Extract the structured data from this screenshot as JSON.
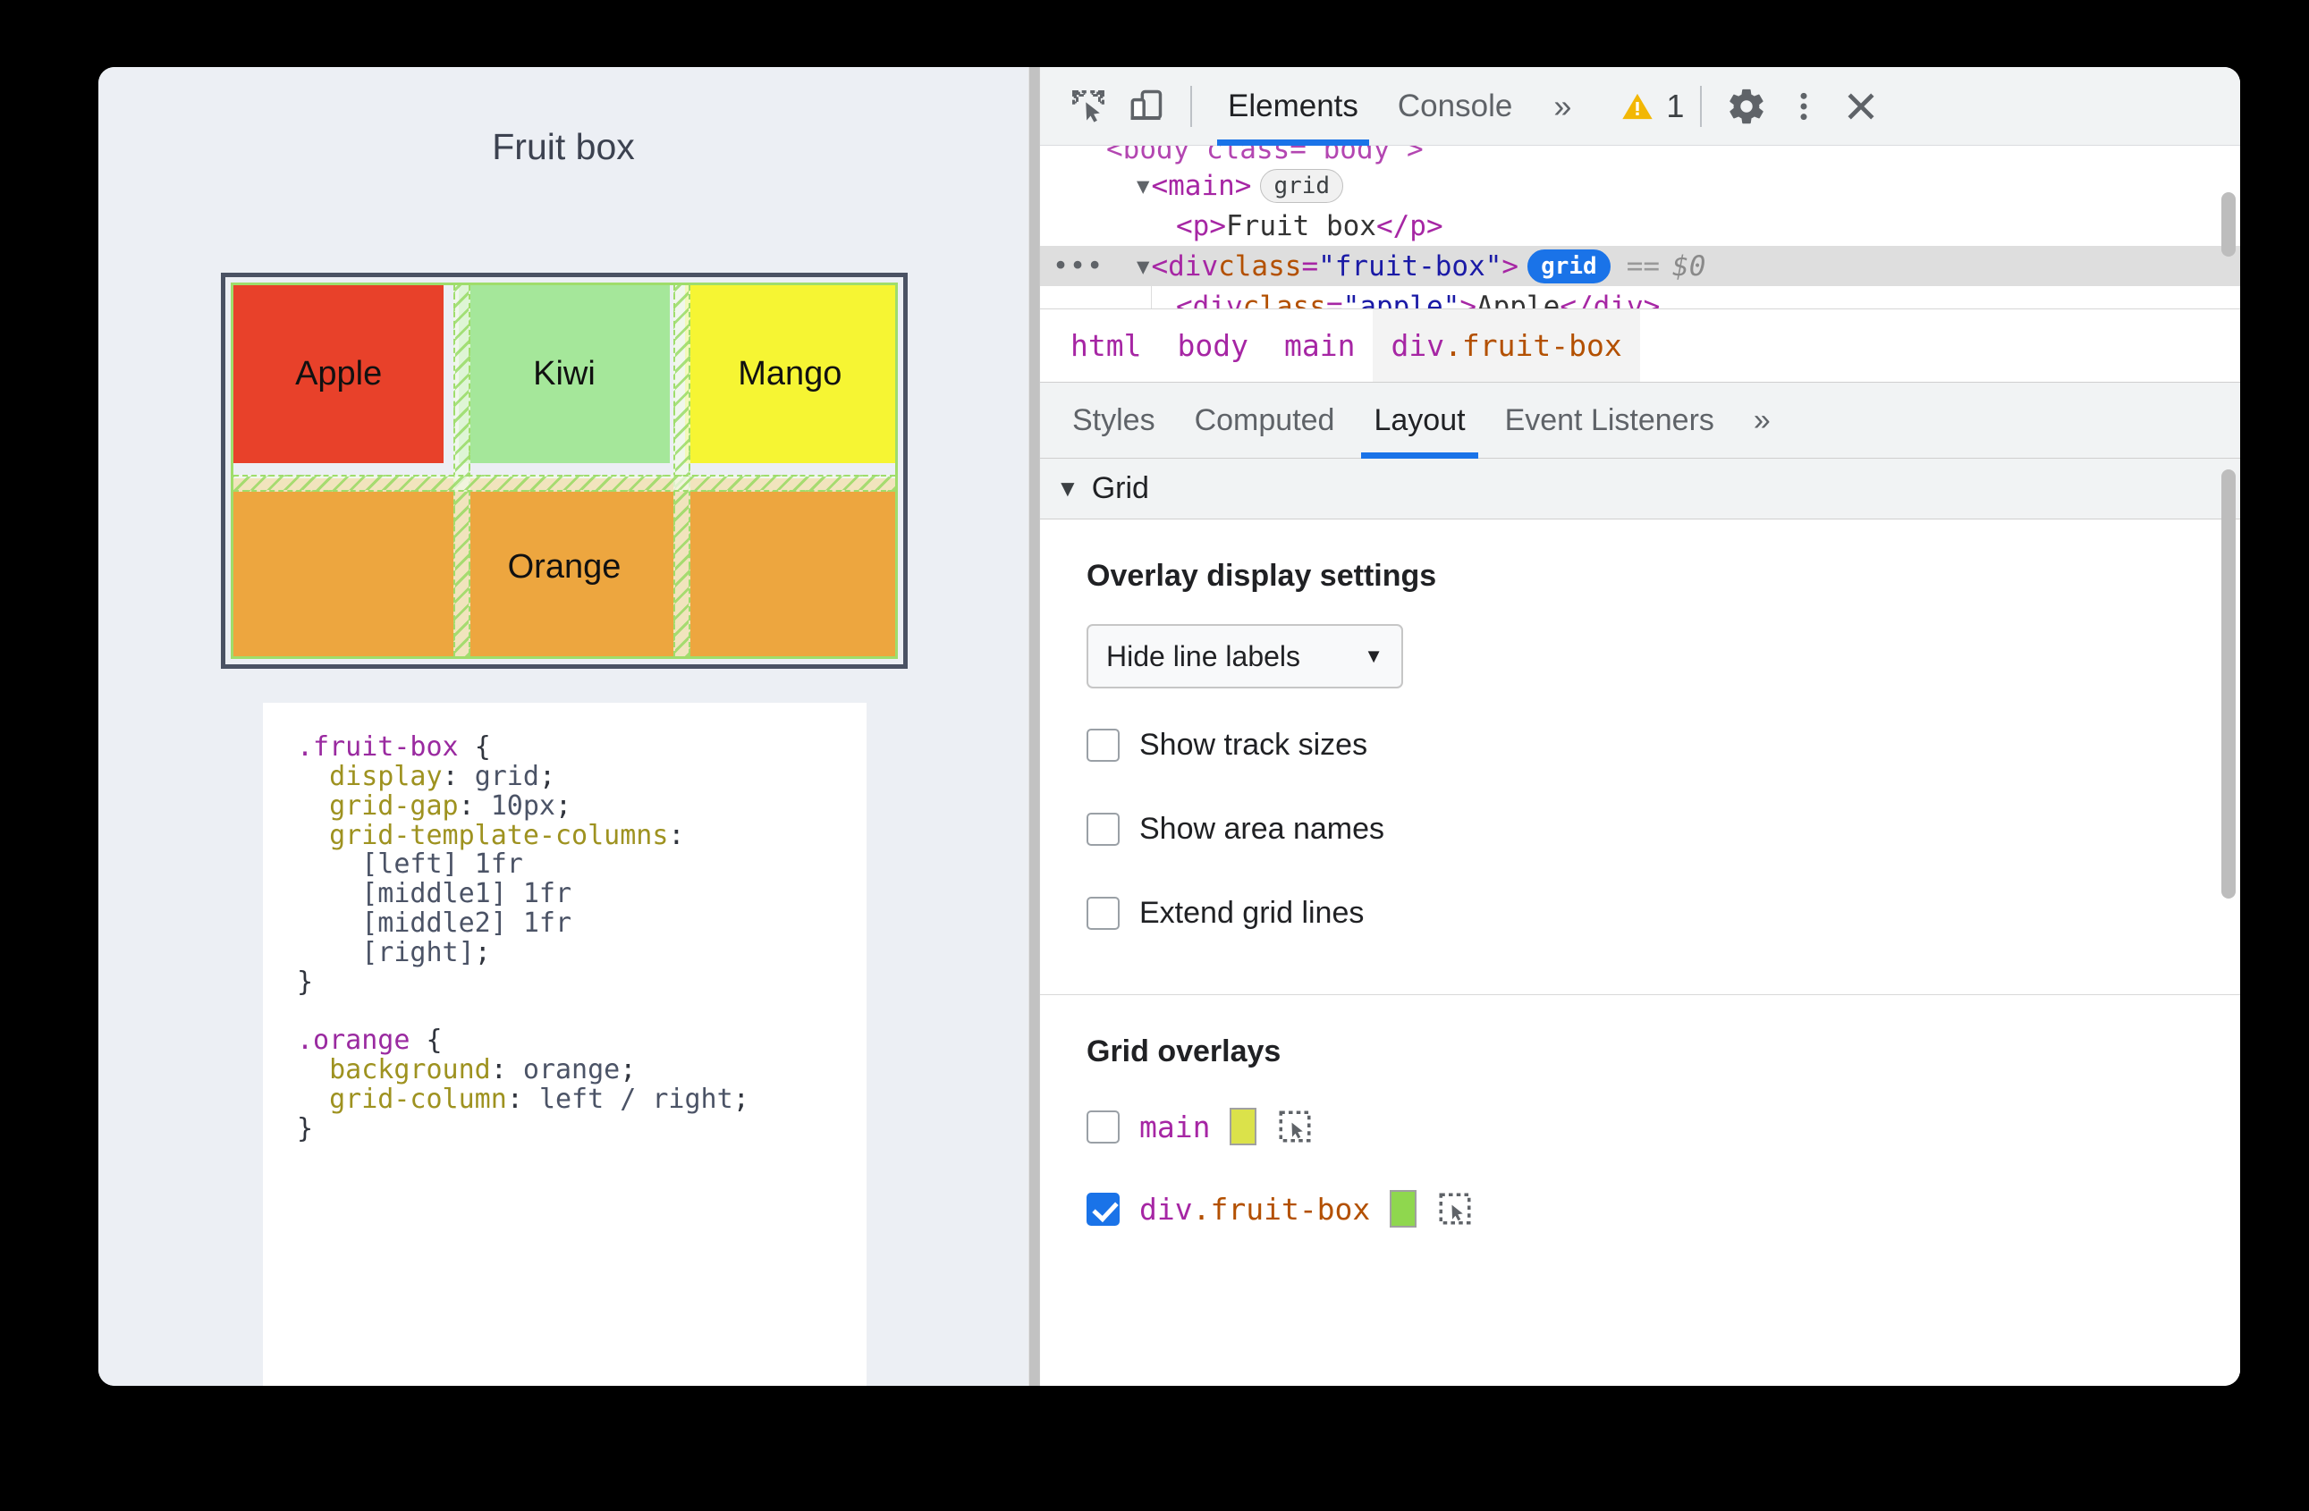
{
  "page": {
    "title": "Fruit box",
    "grid_cells": [
      {
        "label": "Apple",
        "color": "#e8412a"
      },
      {
        "label": "Kiwi",
        "color": "#a5e79a"
      },
      {
        "label": "Mango",
        "color": "#f6f533"
      },
      {
        "label": "Orange",
        "color": "#eda63f"
      }
    ],
    "css_rules": [
      {
        "selector": ".fruit-box",
        "declarations": [
          {
            "property": "display",
            "value": "grid"
          },
          {
            "property": "grid-gap",
            "value": "10px"
          },
          {
            "property": "grid-template-columns",
            "value": "[left] 1fr [middle1] 1fr [middle2] 1fr [right]"
          }
        ]
      },
      {
        "selector": ".orange",
        "declarations": [
          {
            "property": "background",
            "value": "orange"
          },
          {
            "property": "grid-column",
            "value": "left / right"
          }
        ]
      }
    ]
  },
  "devtools": {
    "toolbar": {
      "inspect_icon": "inspect-element-icon",
      "device_icon": "device-toolbar-icon",
      "tabs": [
        {
          "label": "Elements",
          "active": true
        },
        {
          "label": "Console",
          "active": false
        }
      ],
      "more_tabs_label": "»",
      "warning_icon": "warning-triangle-icon",
      "warning_count": "1",
      "settings_icon": "gear-icon",
      "menu_icon": "kebab-menu-icon",
      "close_icon": "close-icon"
    },
    "dom": {
      "rows": [
        {
          "indent": 1,
          "has_arrow": true,
          "open_tag": "<main>",
          "badge": "grid",
          "badge_active": false,
          "selected": false
        },
        {
          "indent": 2,
          "has_arrow": false,
          "open_tag": "<p>",
          "text": "Fruit box",
          "close_tag": "</p>",
          "selected": false
        },
        {
          "indent": 1,
          "has_arrow": true,
          "tag_start": "<div ",
          "attr_name": "class",
          "attr_value": "\"fruit-box\"",
          "tag_end": ">",
          "badge": "grid",
          "badge_active": true,
          "equals": "==",
          "dollar": "$0",
          "selected": true,
          "ellipsis": "•••"
        },
        {
          "indent": 2,
          "has_arrow": false,
          "tag_start": "<div ",
          "attr_name": "class",
          "attr_value": "\"apple\"",
          "tag_end": ">",
          "text": "Apple",
          "close_tag": "</div>",
          "selected": false
        }
      ]
    },
    "breadcrumb": [
      {
        "label": "html",
        "active": false
      },
      {
        "label": "body",
        "active": false
      },
      {
        "label": "main",
        "active": false
      },
      {
        "label": "div",
        "class_part": ".fruit-box",
        "active": true
      }
    ],
    "sidebar_tabs": [
      {
        "label": "Styles",
        "active": false
      },
      {
        "label": "Computed",
        "active": false
      },
      {
        "label": "Layout",
        "active": true
      },
      {
        "label": "Event Listeners",
        "active": false
      }
    ],
    "sidebar_more": "»",
    "layout": {
      "section_title": "Grid",
      "section_expanded": true,
      "overlay_settings": {
        "title": "Overlay display settings",
        "select_value": "Hide line labels",
        "checkboxes": [
          {
            "label": "Show track sizes",
            "checked": false
          },
          {
            "label": "Show area names",
            "checked": false
          },
          {
            "label": "Extend grid lines",
            "checked": false
          }
        ]
      },
      "grid_overlays": {
        "title": "Grid overlays",
        "items": [
          {
            "name": "main",
            "class_part": "",
            "checked": false,
            "color": "#dbe24a",
            "picker_icon": "element-picker-icon"
          },
          {
            "name": "div",
            "class_part": ".fruit-box",
            "checked": true,
            "color": "#8fd74e",
            "picker_icon": "element-picker-icon"
          }
        ]
      }
    }
  },
  "colors": {
    "accent": "#1a73e8",
    "grid_overlay_line": "#9fdd6b",
    "warning": "#f2b705"
  }
}
